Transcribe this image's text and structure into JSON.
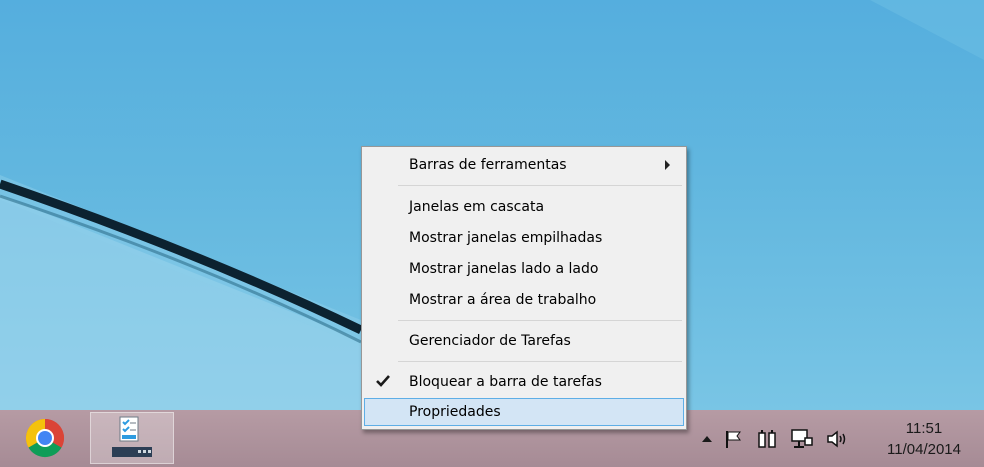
{
  "context_menu": {
    "items": [
      {
        "label": "Barras de ferramentas",
        "submenu": true
      },
      {
        "label": "Janelas em cascata"
      },
      {
        "label": "Mostrar janelas empilhadas"
      },
      {
        "label": "Mostrar janelas lado a lado"
      },
      {
        "label": "Mostrar a área de trabalho"
      },
      {
        "label": "Gerenciador de Tarefas"
      },
      {
        "label": "Bloquear a barra de tarefas",
        "checked": true
      },
      {
        "label": "Propriedades",
        "highlighted": true
      }
    ]
  },
  "taskbar": {
    "pinned": [
      {
        "name": "chrome-icon"
      },
      {
        "name": "task-manager-icon",
        "active": true
      }
    ],
    "tray": {
      "icons": [
        "chevron-up-icon",
        "flag-icon",
        "power-icon",
        "network-icon",
        "volume-icon"
      ],
      "time": "11:51",
      "date": "11/04/2014"
    }
  },
  "colors": {
    "desktop": "#5fb3d9",
    "taskbar": "#ae939d",
    "menu_bg": "#f0f0f0",
    "menu_hover": "#d3e5f5",
    "menu_hover_border": "#5eaee6"
  }
}
